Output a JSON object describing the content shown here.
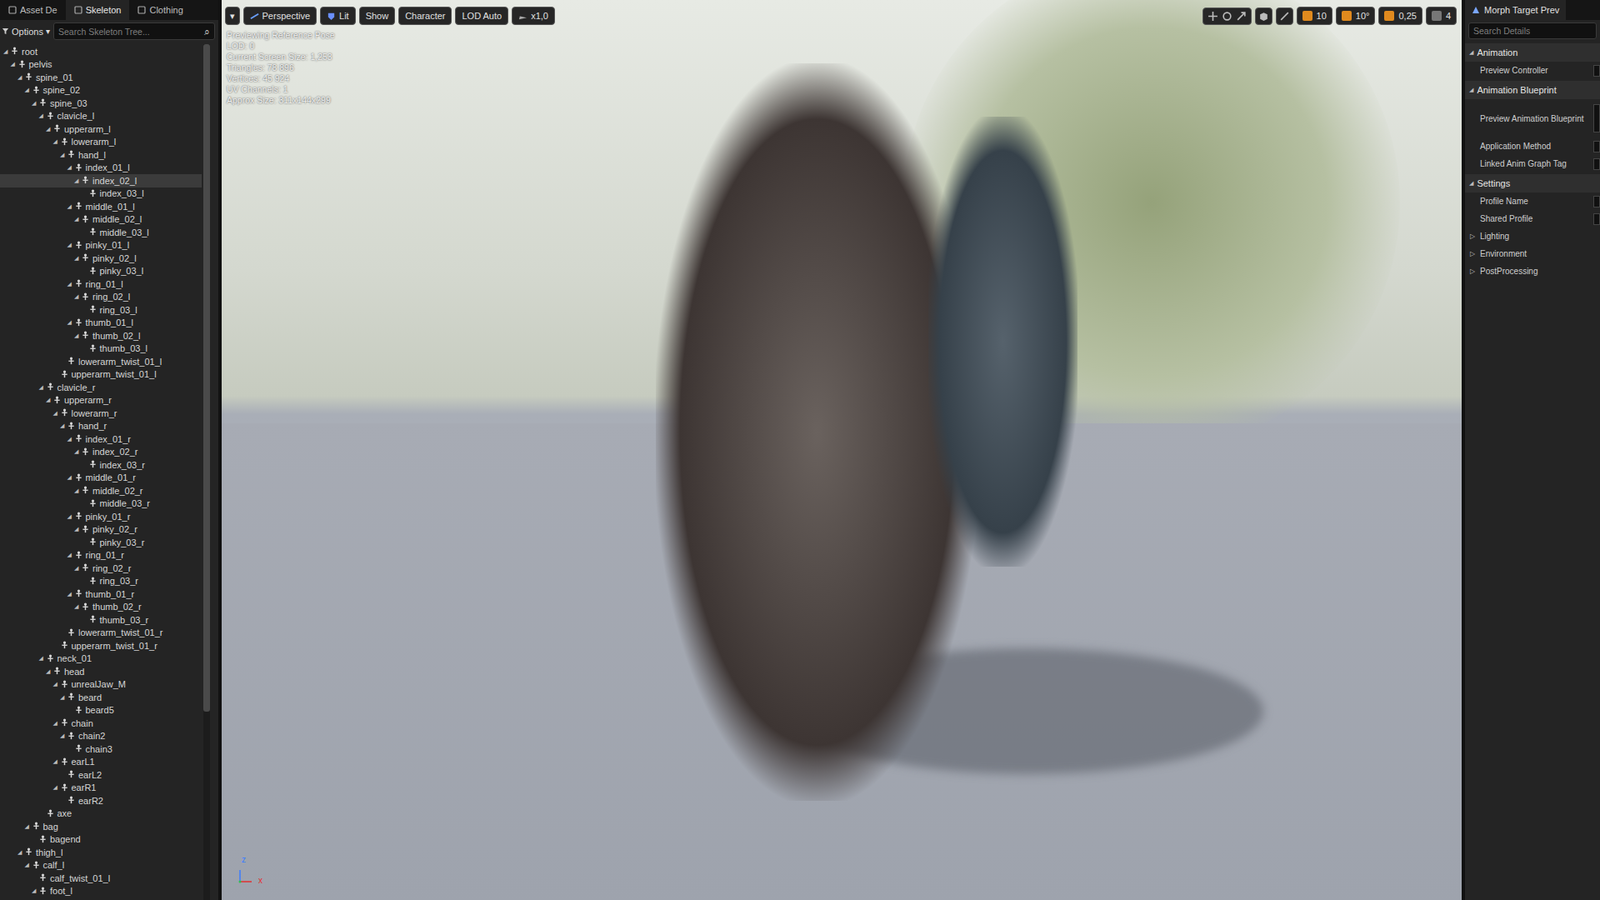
{
  "glyphs": {
    "expanded": "◢",
    "collapsed": "▷",
    "dropdown": "▾",
    "search": "⌕"
  },
  "left_tabs": [
    {
      "label": "Asset De",
      "selected": false
    },
    {
      "label": "Skeleton",
      "selected": true
    },
    {
      "label": "Clothing",
      "selected": false
    }
  ],
  "tree_options": {
    "label": "Options"
  },
  "tree_search": {
    "placeholder": "Search Skeleton Tree..."
  },
  "tree": {
    "scrollbar_level": 0.78,
    "rows": [
      {
        "name": "root",
        "depth": 0,
        "expanded": true,
        "selected": false
      },
      {
        "name": "pelvis",
        "depth": 1,
        "expanded": true,
        "selected": false
      },
      {
        "name": "spine_01",
        "depth": 2,
        "expanded": true,
        "selected": false
      },
      {
        "name": "spine_02",
        "depth": 3,
        "expanded": true,
        "selected": false
      },
      {
        "name": "spine_03",
        "depth": 4,
        "expanded": true,
        "selected": false
      },
      {
        "name": "clavicle_l",
        "depth": 5,
        "expanded": true,
        "selected": false
      },
      {
        "name": "upperarm_l",
        "depth": 6,
        "expanded": true,
        "selected": false
      },
      {
        "name": "lowerarm_l",
        "depth": 7,
        "expanded": true,
        "selected": false
      },
      {
        "name": "hand_l",
        "depth": 8,
        "expanded": true,
        "selected": false
      },
      {
        "name": "index_01_l",
        "depth": 9,
        "expanded": true,
        "selected": false
      },
      {
        "name": "index_02_l",
        "depth": 10,
        "expanded": true,
        "selected": true
      },
      {
        "name": "index_03_l",
        "depth": 11,
        "expanded": false,
        "selected": false
      },
      {
        "name": "middle_01_l",
        "depth": 9,
        "expanded": true,
        "selected": false
      },
      {
        "name": "middle_02_l",
        "depth": 10,
        "expanded": true,
        "selected": false
      },
      {
        "name": "middle_03_l",
        "depth": 11,
        "expanded": false,
        "selected": false
      },
      {
        "name": "pinky_01_l",
        "depth": 9,
        "expanded": true,
        "selected": false
      },
      {
        "name": "pinky_02_l",
        "depth": 10,
        "expanded": true,
        "selected": false
      },
      {
        "name": "pinky_03_l",
        "depth": 11,
        "expanded": false,
        "selected": false
      },
      {
        "name": "ring_01_l",
        "depth": 9,
        "expanded": true,
        "selected": false
      },
      {
        "name": "ring_02_l",
        "depth": 10,
        "expanded": true,
        "selected": false
      },
      {
        "name": "ring_03_l",
        "depth": 11,
        "expanded": false,
        "selected": false
      },
      {
        "name": "thumb_01_l",
        "depth": 9,
        "expanded": true,
        "selected": false
      },
      {
        "name": "thumb_02_l",
        "depth": 10,
        "expanded": true,
        "selected": false
      },
      {
        "name": "thumb_03_l",
        "depth": 11,
        "expanded": false,
        "selected": false
      },
      {
        "name": "lowerarm_twist_01_l",
        "depth": 8,
        "expanded": false,
        "selected": false
      },
      {
        "name": "upperarm_twist_01_l",
        "depth": 7,
        "expanded": false,
        "selected": false
      },
      {
        "name": "clavicle_r",
        "depth": 5,
        "expanded": true,
        "selected": false
      },
      {
        "name": "upperarm_r",
        "depth": 6,
        "expanded": true,
        "selected": false
      },
      {
        "name": "lowerarm_r",
        "depth": 7,
        "expanded": true,
        "selected": false
      },
      {
        "name": "hand_r",
        "depth": 8,
        "expanded": true,
        "selected": false
      },
      {
        "name": "index_01_r",
        "depth": 9,
        "expanded": true,
        "selected": false
      },
      {
        "name": "index_02_r",
        "depth": 10,
        "expanded": true,
        "selected": false
      },
      {
        "name": "index_03_r",
        "depth": 11,
        "expanded": false,
        "selected": false
      },
      {
        "name": "middle_01_r",
        "depth": 9,
        "expanded": true,
        "selected": false
      },
      {
        "name": "middle_02_r",
        "depth": 10,
        "expanded": true,
        "selected": false
      },
      {
        "name": "middle_03_r",
        "depth": 11,
        "expanded": false,
        "selected": false
      },
      {
        "name": "pinky_01_r",
        "depth": 9,
        "expanded": true,
        "selected": false
      },
      {
        "name": "pinky_02_r",
        "depth": 10,
        "expanded": true,
        "selected": false
      },
      {
        "name": "pinky_03_r",
        "depth": 11,
        "expanded": false,
        "selected": false
      },
      {
        "name": "ring_01_r",
        "depth": 9,
        "expanded": true,
        "selected": false
      },
      {
        "name": "ring_02_r",
        "depth": 10,
        "expanded": true,
        "selected": false
      },
      {
        "name": "ring_03_r",
        "depth": 11,
        "expanded": false,
        "selected": false
      },
      {
        "name": "thumb_01_r",
        "depth": 9,
        "expanded": true,
        "selected": false
      },
      {
        "name": "thumb_02_r",
        "depth": 10,
        "expanded": true,
        "selected": false
      },
      {
        "name": "thumb_03_r",
        "depth": 11,
        "expanded": false,
        "selected": false
      },
      {
        "name": "lowerarm_twist_01_r",
        "depth": 8,
        "expanded": false,
        "selected": false
      },
      {
        "name": "upperarm_twist_01_r",
        "depth": 7,
        "expanded": false,
        "selected": false
      },
      {
        "name": "neck_01",
        "depth": 5,
        "expanded": true,
        "selected": false
      },
      {
        "name": "head",
        "depth": 6,
        "expanded": true,
        "selected": false
      },
      {
        "name": "unrealJaw_M",
        "depth": 7,
        "expanded": true,
        "selected": false
      },
      {
        "name": "beard",
        "depth": 8,
        "expanded": true,
        "selected": false
      },
      {
        "name": "beard5",
        "depth": 9,
        "expanded": false,
        "selected": false
      },
      {
        "name": "chain",
        "depth": 7,
        "expanded": true,
        "selected": false
      },
      {
        "name": "chain2",
        "depth": 8,
        "expanded": true,
        "selected": false
      },
      {
        "name": "chain3",
        "depth": 9,
        "expanded": false,
        "selected": false
      },
      {
        "name": "earL1",
        "depth": 7,
        "expanded": true,
        "selected": false
      },
      {
        "name": "earL2",
        "depth": 8,
        "expanded": false,
        "selected": false
      },
      {
        "name": "earR1",
        "depth": 7,
        "expanded": true,
        "selected": false
      },
      {
        "name": "earR2",
        "depth": 8,
        "expanded": false,
        "selected": false
      },
      {
        "name": "axe",
        "depth": 5,
        "expanded": false,
        "selected": false
      },
      {
        "name": "bag",
        "depth": 3,
        "expanded": true,
        "selected": false
      },
      {
        "name": "bagend",
        "depth": 4,
        "expanded": false,
        "selected": false
      },
      {
        "name": "thigh_l",
        "depth": 2,
        "expanded": true,
        "selected": false
      },
      {
        "name": "calf_l",
        "depth": 3,
        "expanded": true,
        "selected": false
      },
      {
        "name": "calf_twist_01_l",
        "depth": 4,
        "expanded": false,
        "selected": false
      },
      {
        "name": "foot_l",
        "depth": 4,
        "expanded": true,
        "selected": false
      }
    ]
  },
  "viewport": {
    "toolbar_left": [
      {
        "label": "Perspective",
        "icon": "camera"
      },
      {
        "label": "Lit",
        "icon": "lit"
      },
      {
        "label": "Show",
        "icon": "none"
      },
      {
        "label": "Character",
        "icon": "none"
      },
      {
        "label": "LOD Auto",
        "icon": "none"
      },
      {
        "label": "x1,0",
        "icon": "speed"
      }
    ],
    "toolbar_right": [
      {
        "value": "10",
        "active": true
      },
      {
        "value": "10°",
        "active": true
      },
      {
        "value": "0,25",
        "active": true
      },
      {
        "value": "4",
        "active": false
      }
    ],
    "stats": [
      "Previewing Reference Pose",
      "LOD: 0",
      "Current Screen Size: 1,253",
      "Triangles: 78 896",
      "Vertices: 45 924",
      "UV Channels: 1",
      "Approx Size: 311x144x299"
    ],
    "axis": {
      "z": "z",
      "x": "x"
    }
  },
  "details": {
    "tab": "Morph Target Prev",
    "search": {
      "placeholder": "Search Details"
    },
    "sections": [
      {
        "title": "Animation",
        "expanded": true,
        "rows": [
          {
            "label": "Preview Controller",
            "kind": "field",
            "expanded": false
          }
        ]
      },
      {
        "title": "Animation Blueprint",
        "expanded": true,
        "rows": [
          {
            "label": "Preview Animation Blueprint",
            "kind": "asset",
            "expanded": false
          },
          {
            "label": "Application Method",
            "kind": "field",
            "expanded": false
          },
          {
            "label": "Linked Anim Graph Tag",
            "kind": "field",
            "expanded": false
          }
        ]
      },
      {
        "title": "Settings",
        "expanded": true,
        "rows": [
          {
            "label": "Profile Name",
            "kind": "field",
            "expanded": false
          },
          {
            "label": "Shared Profile",
            "kind": "check",
            "expanded": false
          },
          {
            "label": "Lighting",
            "kind": "group",
            "expanded": false
          },
          {
            "label": "Environment",
            "kind": "group",
            "expanded": false
          },
          {
            "label": "PostProcessing",
            "kind": "group",
            "expanded": false
          }
        ]
      }
    ]
  }
}
